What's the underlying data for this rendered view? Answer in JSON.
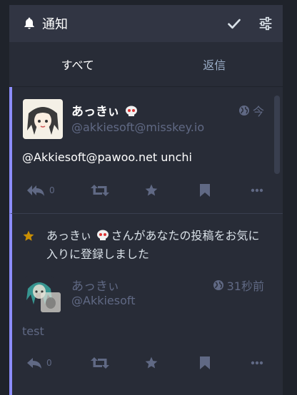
{
  "header": {
    "title": "通知",
    "icon": "bell-icon",
    "actions": [
      "check-icon",
      "sliders-icon"
    ]
  },
  "tabs": [
    {
      "label": "すべて",
      "active": true
    },
    {
      "label": "返信",
      "active": false
    }
  ],
  "statuses": [
    {
      "display_name": "あっきぃ",
      "acct": "@akkiesoft@misskey.io",
      "time": "今",
      "visibility_icon": "globe-icon",
      "content": "@Akkiesoft@pawoo.net unchi",
      "reply_count": "0"
    },
    {
      "notification": "あっきぃ",
      "notification_text": "さんがあなたの投稿をお気に入りに登録しました",
      "display_name": "あっきぃ",
      "acct": "@Akkiesoft",
      "time": "31秒前",
      "visibility_icon": "globe-icon",
      "content": "test",
      "reply_count": "0"
    }
  ],
  "colors": {
    "accent": "#8c8dff",
    "star": "#ca8f04",
    "muted": "#606984"
  }
}
